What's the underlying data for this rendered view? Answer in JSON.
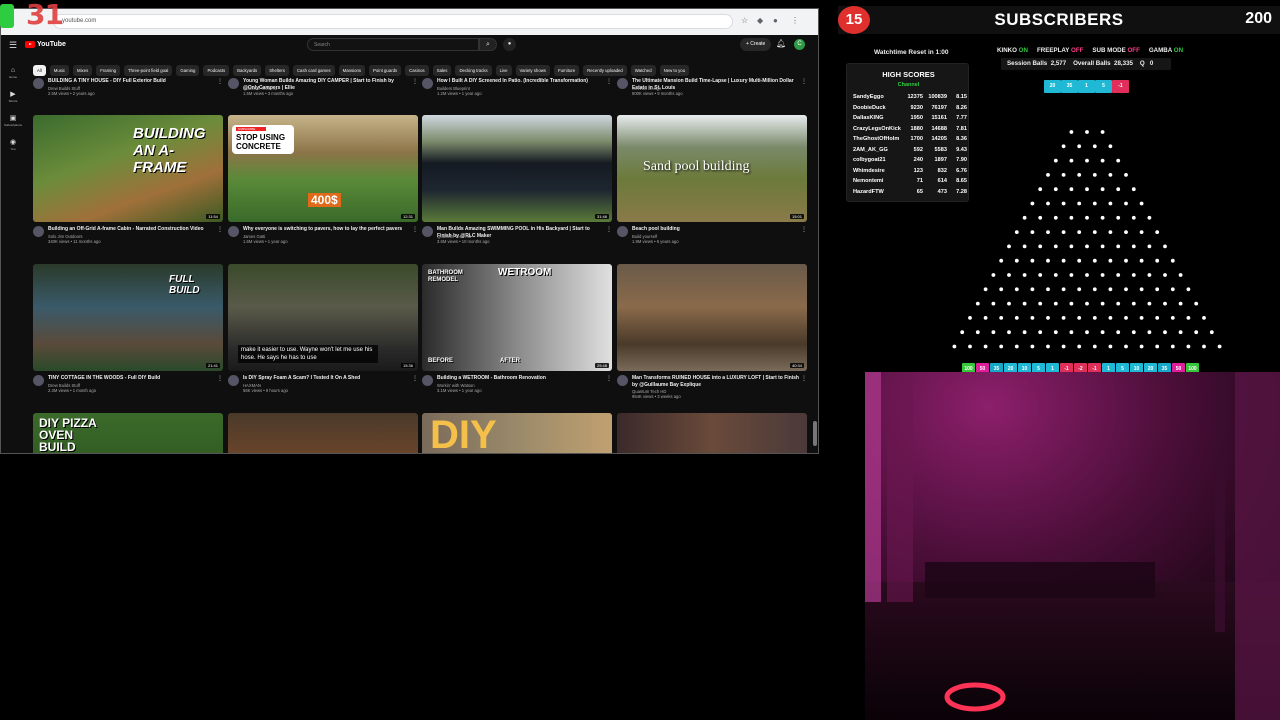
{
  "overlay_counter": "31",
  "browser": {
    "url": "youtube.com",
    "youtube": {
      "logo_text": "YouTube",
      "search_placeholder": "Search",
      "create_label": "+ Create",
      "avatar_letter": "C",
      "chips": [
        "All",
        "Music",
        "Mixes",
        "Framing",
        "Three-point field goal",
        "Gaming",
        "Podcasts",
        "Backyards",
        "Shelters",
        "Cash card games",
        "Mansions",
        "Point guards",
        "Casinos",
        "Sales",
        "Decking tracks",
        "Live",
        "Variety shows",
        "Furniture",
        "Recently uploaded",
        "Watched",
        "New to you"
      ],
      "sidebar": [
        "Home",
        "Shorts",
        "Subscriptions",
        "You"
      ],
      "top_row": [
        {
          "title": "BUILDING A TINY HOUSE - DIY Full Exterior Build",
          "channel": "Drew Builds Stuff",
          "meta": "2.5M views • 2 years ago"
        },
        {
          "title": "Young Woman Builds Amazing DIY CAMPER | Start to Finish by @OnlyCampers | Ellie",
          "channel": "Quantum Tech HD",
          "meta": "1.5M views • 3 months ago"
        },
        {
          "title": "How I Built A DIY Screened In Patio. (Incredible Transformation)",
          "channel": "Builders Blueprint",
          "meta": "1.2M views • 1 year ago"
        },
        {
          "title": "The Ultimate Mansion Build Time-Lapse | Luxury Multi-Million Dollar Estate in St. Louis",
          "channel": "KINVLD Design",
          "meta": "800K views • 9 months ago"
        }
      ],
      "videos": [
        {
          "title": "Building an Off-Grid A-frame Cabin - Narrated Construction Video",
          "channel": "Solo Jim Outdoors",
          "meta": "340K views • 11 months ago",
          "duration": "11:54",
          "overlay": "BUILDING AN A-FRAME"
        },
        {
          "title": "Why everyone is switching to pavers, how to lay the perfect pavers",
          "channel": "James Gatti",
          "meta": "1.6M views • 1 year ago",
          "duration": "12:31",
          "overlay": "STOP USING CONCRETE",
          "price": "400$",
          "badge": "SUBSCRIBE"
        },
        {
          "title": "Man Builds Amazing SWIMMING POOL in His Backyard | Start to Finish by @RLC Maker",
          "channel": "Quantum Tech HD",
          "meta": "3.6M views • 10 months ago",
          "duration": "31:46"
        },
        {
          "title": "Beach pool building",
          "channel": "Build yourself",
          "meta": "1.9M views • 6 years ago",
          "duration": "15:01",
          "overlay": "Sand pool building"
        },
        {
          "title": "TINY COTTAGE IN THE WOODS - Full DIY Build",
          "channel": "Drew Builds Stuff",
          "meta": "2.3M views • 1 month ago",
          "duration": "21:41",
          "overlay": "FULL BUILD"
        },
        {
          "title": "Is DIY Spray Foam A Scam? I Tested It On A Shed",
          "channel": "HAXMAN",
          "meta": "56K views • 9 hours ago",
          "duration": "15:36",
          "caption": "make it easier to use. Wayne won't let me use his hose. He says he has to use"
        },
        {
          "title": "Building a WETROOM - Bathroom Renovation",
          "channel": "Workin' with Watson",
          "meta": "3.1M views • 1 year ago",
          "duration": "25:48",
          "overlay_top_left": "BATHROOM REMODEL",
          "overlay_top_right": "WETROOM",
          "before": "BEFORE",
          "after": "AFTER"
        },
        {
          "title": "Man Transforms RUINED HOUSE into a LUXURY LOFT | Start to Finish by @Guillaume Bay Explique",
          "channel": "Quantum Tech HD",
          "meta": "954K views • 3 weeks ago",
          "duration": "40:34"
        },
        {
          "title": "",
          "overlay": "DIY PIZZA OVEN BUILD"
        },
        {
          "title": ""
        },
        {
          "title": "",
          "overlay": "DIY"
        },
        {
          "title": ""
        }
      ]
    }
  },
  "stream": {
    "sub_left": "15",
    "sub_title": "SUBSCRIBERS",
    "sub_right": "200",
    "watchtime": "Watchtime Reset in 1:00",
    "high_scores_title": "HIGH SCORES",
    "high_scores_sub": "Channel",
    "high_scores": [
      {
        "name": "SandyEggo",
        "a": "12375",
        "b": "100839",
        "c": "8.15"
      },
      {
        "name": "DoobieDuck",
        "a": "9230",
        "b": "76197",
        "c": "8.26"
      },
      {
        "name": "DallasKING",
        "a": "1950",
        "b": "15161",
        "c": "7.77"
      },
      {
        "name": "CrazyLegsOnKick",
        "a": "1880",
        "b": "14688",
        "c": "7.81"
      },
      {
        "name": "TheGhostOfHolm",
        "a": "1700",
        "b": "14205",
        "c": "8.36"
      },
      {
        "name": "2AM_AK_GG",
        "a": "592",
        "b": "5583",
        "c": "9.43"
      },
      {
        "name": "colbygoat21",
        "a": "240",
        "b": "1897",
        "c": "7.90"
      },
      {
        "name": "Whimdesire",
        "a": "123",
        "b": "832",
        "c": "6.76"
      },
      {
        "name": "Nemontemi",
        "a": "71",
        "b": "614",
        "c": "8.65"
      },
      {
        "name": "HazardFTW",
        "a": "65",
        "b": "473",
        "c": "7.28"
      }
    ],
    "toggles": [
      {
        "label": "KINKO",
        "state": "ON"
      },
      {
        "label": "FREEPLAY",
        "state": "OFF"
      },
      {
        "label": "SUB MODE",
        "state": "OFF"
      },
      {
        "label": "GAMBA",
        "state": "ON"
      }
    ],
    "session_label": "Session Balls",
    "session_value": "2,577",
    "overall_label": "Overall Balls",
    "overall_value": "28,335",
    "q_label": "Q",
    "q_value": "0",
    "preview_slots": [
      "20",
      "35",
      "1",
      "5",
      "-1"
    ],
    "preview_colors": [
      "#1fb9d6",
      "#1fb9d6",
      "#1fb9d6",
      "#1fb9d6",
      "#e22e5a"
    ],
    "slots": [
      "100",
      "50",
      "35",
      "20",
      "10",
      "5",
      "1",
      "-1",
      "-2",
      "-1",
      "1",
      "5",
      "10",
      "20",
      "35",
      "50",
      "100"
    ],
    "slot_colors": [
      "#36c83a",
      "#e01e9a",
      "#16a8c8",
      "#1fb9d6",
      "#1fb9d6",
      "#1fb9d6",
      "#1fb9d6",
      "#e22e5a",
      "#e22e5a",
      "#e22e5a",
      "#1fb9d6",
      "#1fb9d6",
      "#1fb9d6",
      "#1fb9d6",
      "#16a8c8",
      "#e01e9a",
      "#36c83a"
    ]
  }
}
